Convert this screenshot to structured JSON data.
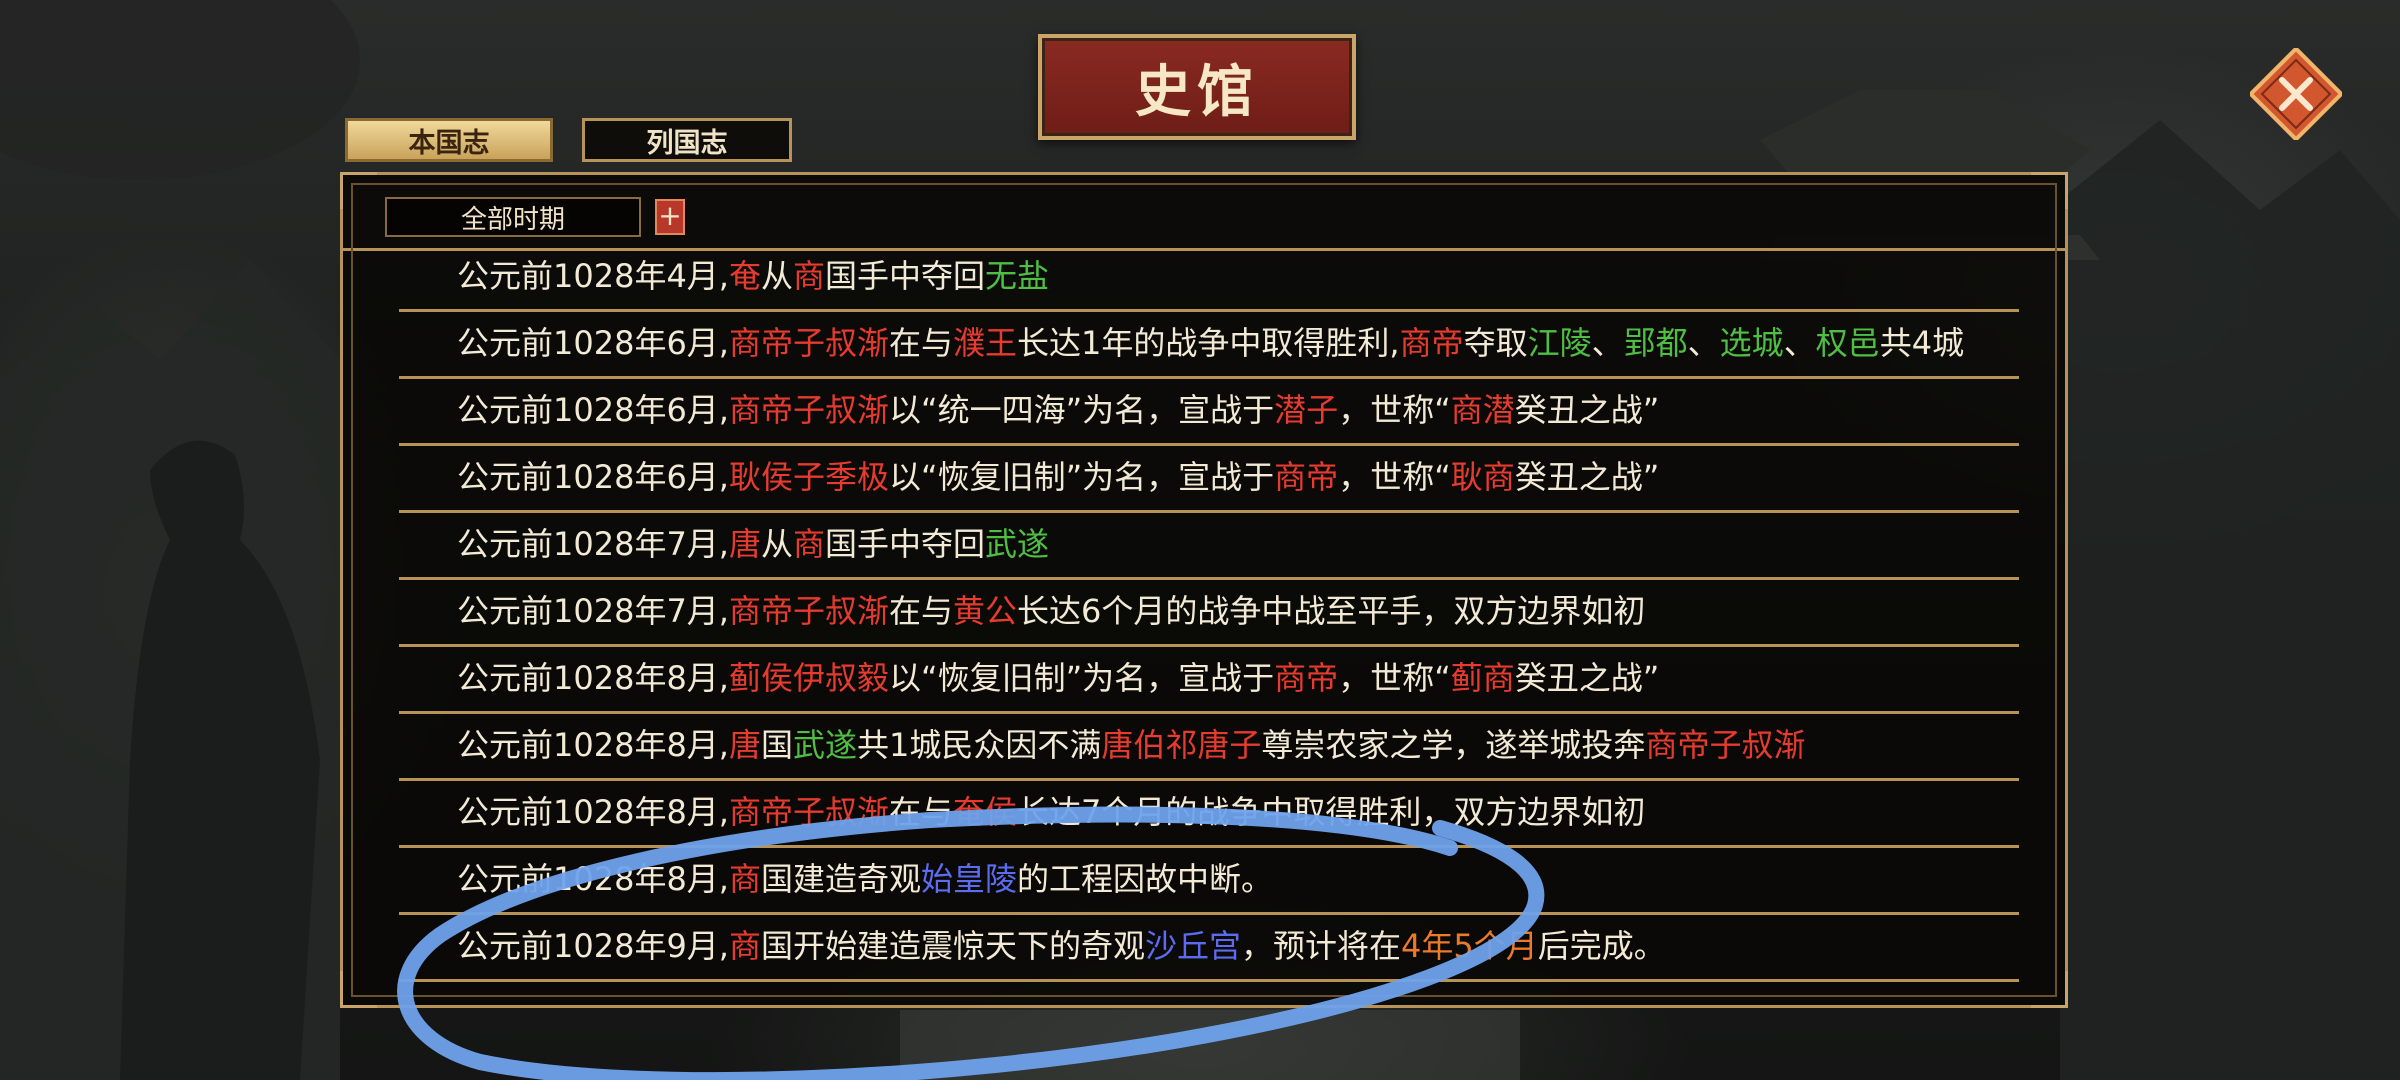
{
  "window": {
    "title": "史馆"
  },
  "tabs": [
    {
      "label": "本国志",
      "active": true
    },
    {
      "label": "列国志",
      "active": false
    }
  ],
  "filter": {
    "period": "全部时期",
    "add_label": "+"
  },
  "colors": {
    "red": "#e63b2e",
    "green": "#4fbf43",
    "blue": "#5b6cf0",
    "orange": "#ec7a2c",
    "text": "#f3ead6",
    "gold_border": "#b89358",
    "annotation_stroke": "#6fa2ec"
  },
  "icons": {
    "close": "close-icon"
  },
  "log_entries": [
    {
      "segments": [
        {
          "t": "公元前1028年4月,",
          "c": ""
        },
        {
          "t": "奄",
          "c": "red"
        },
        {
          "t": "从",
          "c": ""
        },
        {
          "t": "商",
          "c": "red"
        },
        {
          "t": "国手中夺回",
          "c": ""
        },
        {
          "t": "无盐",
          "c": "green"
        }
      ]
    },
    {
      "segments": [
        {
          "t": "公元前1028年6月,",
          "c": ""
        },
        {
          "t": "商帝子叔渐",
          "c": "red"
        },
        {
          "t": "在与",
          "c": ""
        },
        {
          "t": "濮王",
          "c": "red"
        },
        {
          "t": "长达1年的战争中取得胜利,",
          "c": ""
        },
        {
          "t": "商帝",
          "c": "red"
        },
        {
          "t": "夺取",
          "c": ""
        },
        {
          "t": "江陵",
          "c": "green"
        },
        {
          "t": "、",
          "c": ""
        },
        {
          "t": "郢都",
          "c": "green"
        },
        {
          "t": "、",
          "c": ""
        },
        {
          "t": "选城",
          "c": "green"
        },
        {
          "t": "、",
          "c": ""
        },
        {
          "t": "权邑",
          "c": "green"
        },
        {
          "t": "共4城",
          "c": ""
        }
      ]
    },
    {
      "segments": [
        {
          "t": "公元前1028年6月,",
          "c": ""
        },
        {
          "t": "商帝子叔渐",
          "c": "red"
        },
        {
          "t": "以“统一四海”为名，宣战于",
          "c": ""
        },
        {
          "t": "潜子",
          "c": "red"
        },
        {
          "t": "，世称“",
          "c": ""
        },
        {
          "t": "商潜",
          "c": "red"
        },
        {
          "t": "癸丑之战”",
          "c": ""
        }
      ]
    },
    {
      "segments": [
        {
          "t": "公元前1028年6月,",
          "c": ""
        },
        {
          "t": "耿侯子季极",
          "c": "red"
        },
        {
          "t": "以“恢复旧制”为名，宣战于",
          "c": ""
        },
        {
          "t": "商帝",
          "c": "red"
        },
        {
          "t": "，世称“",
          "c": ""
        },
        {
          "t": "耿商",
          "c": "red"
        },
        {
          "t": "癸丑之战”",
          "c": ""
        }
      ]
    },
    {
      "segments": [
        {
          "t": "公元前1028年7月,",
          "c": ""
        },
        {
          "t": "唐",
          "c": "red"
        },
        {
          "t": "从",
          "c": ""
        },
        {
          "t": "商",
          "c": "red"
        },
        {
          "t": "国手中夺回",
          "c": ""
        },
        {
          "t": "武遂",
          "c": "green"
        }
      ]
    },
    {
      "segments": [
        {
          "t": "公元前1028年7月,",
          "c": ""
        },
        {
          "t": "商帝子叔渐",
          "c": "red"
        },
        {
          "t": "在与",
          "c": ""
        },
        {
          "t": "黄公",
          "c": "red"
        },
        {
          "t": "长达6个月的战争中战至平手，双方边界如初",
          "c": ""
        }
      ]
    },
    {
      "segments": [
        {
          "t": "公元前1028年8月,",
          "c": ""
        },
        {
          "t": "蓟侯伊叔毅",
          "c": "red"
        },
        {
          "t": "以“恢复旧制”为名，宣战于",
          "c": ""
        },
        {
          "t": "商帝",
          "c": "red"
        },
        {
          "t": "，世称“",
          "c": ""
        },
        {
          "t": "蓟商",
          "c": "red"
        },
        {
          "t": "癸丑之战”",
          "c": ""
        }
      ]
    },
    {
      "segments": [
        {
          "t": "公元前1028年8月,",
          "c": ""
        },
        {
          "t": "唐",
          "c": "red"
        },
        {
          "t": "国",
          "c": ""
        },
        {
          "t": "武遂",
          "c": "green"
        },
        {
          "t": "共1城民众因不满",
          "c": ""
        },
        {
          "t": "唐伯祁唐子",
          "c": "red"
        },
        {
          "t": "尊崇农家之学，遂举城投奔",
          "c": ""
        },
        {
          "t": "商帝子叔渐",
          "c": "red"
        }
      ]
    },
    {
      "segments": [
        {
          "t": "公元前1028年8月,",
          "c": ""
        },
        {
          "t": "商帝子叔渐",
          "c": "red"
        },
        {
          "t": "在与",
          "c": ""
        },
        {
          "t": "奄侯",
          "c": "red"
        },
        {
          "t": "长达7个月的战争中取得胜利，双方边界如初",
          "c": ""
        }
      ]
    },
    {
      "segments": [
        {
          "t": "公元前1028年8月,",
          "c": ""
        },
        {
          "t": "商",
          "c": "red"
        },
        {
          "t": "国建造奇观",
          "c": ""
        },
        {
          "t": "始皇陵",
          "c": "blue"
        },
        {
          "t": "的工程因故中断。",
          "c": ""
        }
      ]
    },
    {
      "segments": [
        {
          "t": "公元前1028年9月,",
          "c": ""
        },
        {
          "t": "商",
          "c": "red"
        },
        {
          "t": "国开始建造震惊天下的奇观",
          "c": ""
        },
        {
          "t": "沙丘宫",
          "c": "blue"
        },
        {
          "t": "，预计将在",
          "c": ""
        },
        {
          "t": "4年5个月",
          "c": "orange"
        },
        {
          "t": "后完成。",
          "c": ""
        }
      ]
    }
  ]
}
